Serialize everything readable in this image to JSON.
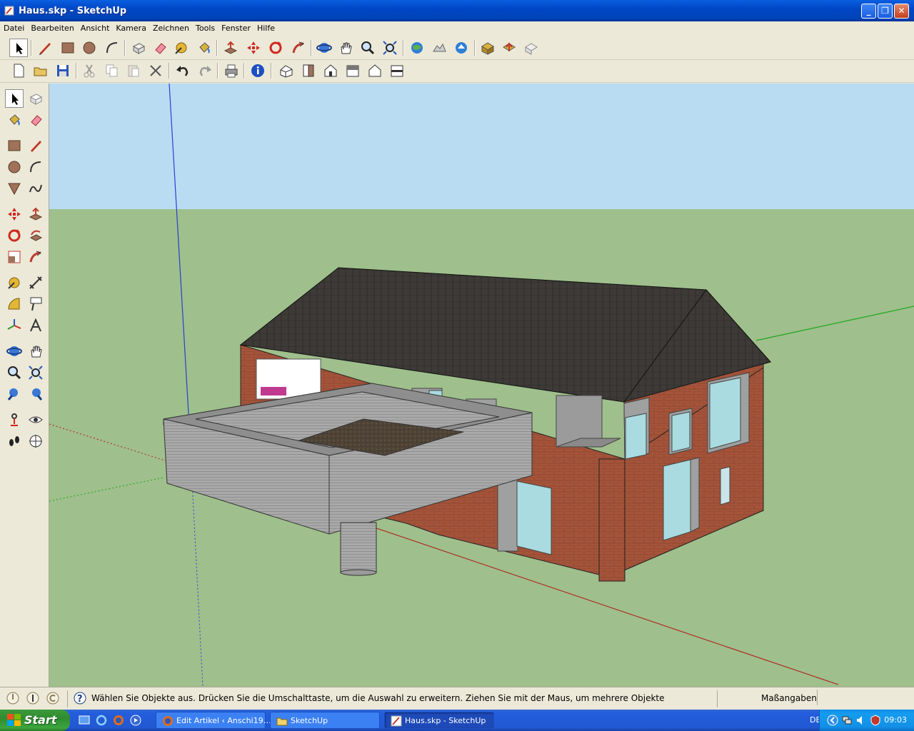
{
  "window": {
    "title": "Haus.skp - SketchUp",
    "min_label": "_",
    "max_label": "❐",
    "close_label": "✕"
  },
  "menu": [
    "Datei",
    "Bearbeiten",
    "Ansicht",
    "Kamera",
    "Zeichnen",
    "Tools",
    "Fenster",
    "Hilfe"
  ],
  "toolbar1": [
    "select-icon",
    "pencil-icon",
    "rectangle-icon",
    "circle-icon",
    "arc-icon",
    "make-component-icon",
    "eraser-icon",
    "tape-measure-icon",
    "paint-bucket-icon",
    "push-pull-icon",
    "move-icon",
    "rotate-icon",
    "follow-me-icon",
    "orbit-icon",
    "pan-icon",
    "zoom-icon",
    "zoom-extents-icon",
    "get-current-view-icon",
    "toggle-terrain-icon",
    "place-model-icon",
    "get-models-icon",
    "share-model-icon",
    "share-component-icon"
  ],
  "toolbar2": [
    "new-icon",
    "open-icon",
    "save-icon",
    "cut-icon",
    "copy-icon",
    "paste-icon",
    "erase-icon",
    "undo-icon",
    "redo-icon",
    "print-icon",
    "model-info-icon",
    "iso-view-icon",
    "top-view-icon",
    "front-view-icon",
    "right-view-icon",
    "back-view-icon",
    "left-view-icon"
  ],
  "status": {
    "hint": "Wählen Sie Objekte aus. Drücken Sie die Umschalttaste, um die Auswahl zu erweitern. Ziehen Sie mit der Maus, um mehrere Objekte",
    "measure_label": "Maßangaben",
    "measure_value": ""
  },
  "taskbar": {
    "start": "Start",
    "tasks": [
      "Edit Artikel ‹ Anschi19…",
      "SketchUp",
      "Haus.skp - SketchUp"
    ],
    "lang": "DE",
    "clock": "09:03"
  },
  "colors": {
    "sky": "#b9dcf3",
    "ground": "#9fbf8c",
    "brick": "#a5543a",
    "roof": "#3d3a37",
    "concrete": "#a7a7a7"
  }
}
